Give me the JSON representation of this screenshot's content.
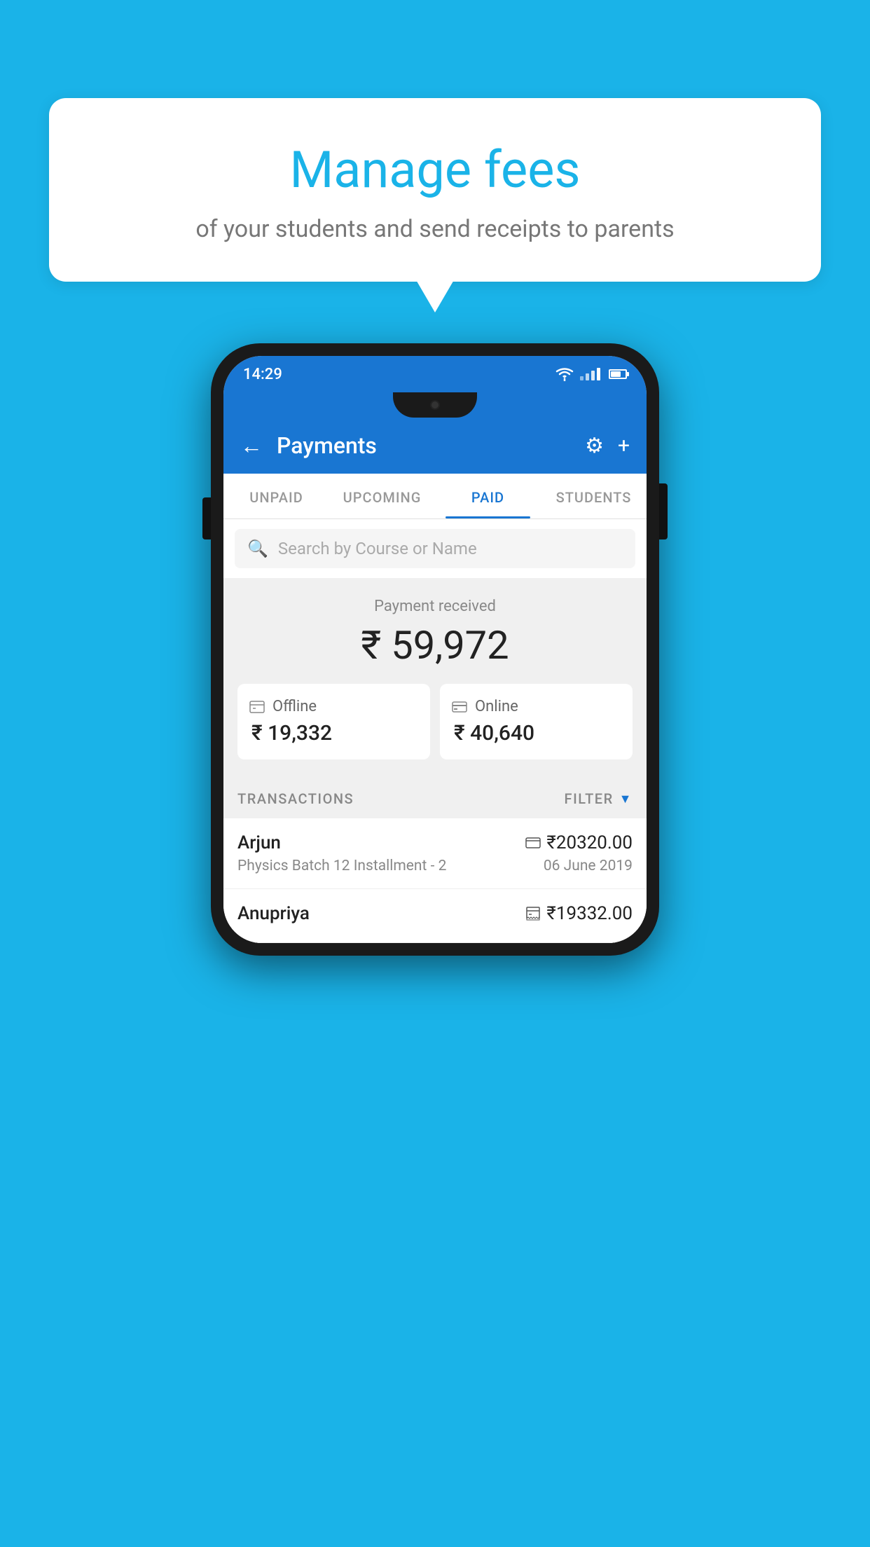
{
  "background": {
    "color": "#1ab3e8"
  },
  "speech_bubble": {
    "title": "Manage fees",
    "subtitle": "of your students and send receipts to parents"
  },
  "phone": {
    "status_bar": {
      "time": "14:29"
    },
    "app_bar": {
      "title": "Payments",
      "back_label": "←",
      "gear_label": "⚙",
      "plus_label": "+"
    },
    "tabs": [
      {
        "label": "UNPAID",
        "active": false
      },
      {
        "label": "UPCOMING",
        "active": false
      },
      {
        "label": "PAID",
        "active": true
      },
      {
        "label": "STUDENTS",
        "active": false
      }
    ],
    "search": {
      "placeholder": "Search by Course or Name"
    },
    "payment_summary": {
      "received_label": "Payment received",
      "total_amount": "₹ 59,972",
      "offline": {
        "label": "Offline",
        "amount": "₹ 19,332"
      },
      "online": {
        "label": "Online",
        "amount": "₹ 40,640"
      }
    },
    "transactions": {
      "section_label": "TRANSACTIONS",
      "filter_label": "FILTER",
      "rows": [
        {
          "name": "Arjun",
          "amount": "₹20320.00",
          "payment_type": "online",
          "course": "Physics Batch 12 Installment - 2",
          "date": "06 June 2019"
        },
        {
          "name": "Anupriya",
          "amount": "₹19332.00",
          "payment_type": "offline",
          "course": "",
          "date": ""
        }
      ]
    }
  }
}
